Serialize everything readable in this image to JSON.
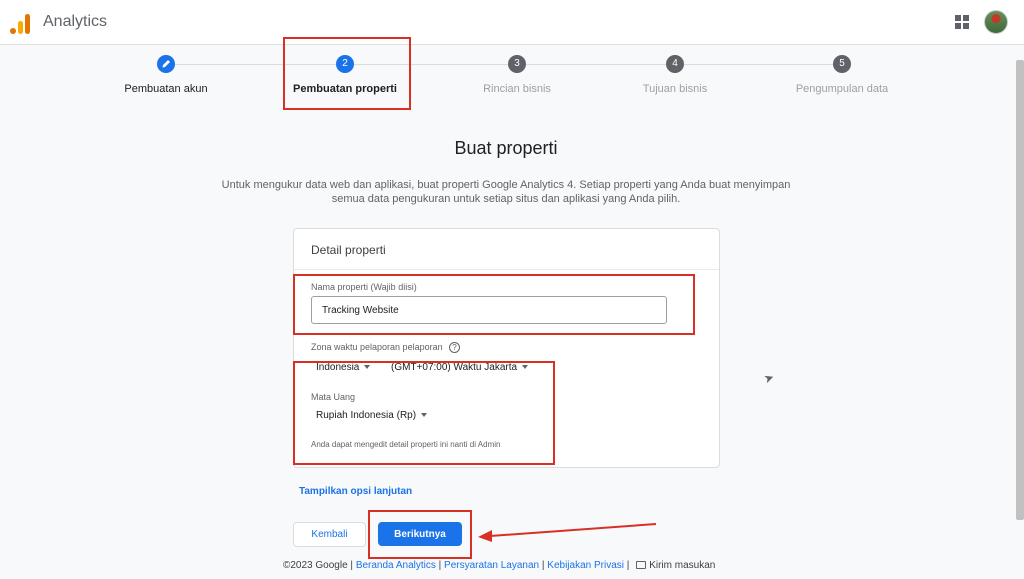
{
  "header": {
    "app_title": "Analytics",
    "apps_icon": "apps-grid-icon",
    "avatar_icon": "user-avatar"
  },
  "stepper": {
    "steps": [
      {
        "number": "",
        "label": "Pembuatan akun",
        "state": "done"
      },
      {
        "number": "2",
        "label": "Pembuatan properti",
        "state": "current"
      },
      {
        "number": "3",
        "label": "Rincian bisnis",
        "state": "todo"
      },
      {
        "number": "4",
        "label": "Tujuan bisnis",
        "state": "todo"
      },
      {
        "number": "5",
        "label": "Pengumpulan data",
        "state": "todo"
      }
    ]
  },
  "main": {
    "heading": "Buat properti",
    "intro": "Untuk mengukur data web dan aplikasi, buat properti Google Analytics 4. Setiap properti yang Anda buat menyimpan semua data pengukuran untuk setiap situs dan aplikasi yang Anda pilih."
  },
  "card": {
    "title": "Detail properti",
    "property_name_label": "Nama properti (Wajib diisi)",
    "property_name_value": "Tracking Website",
    "timezone_label": "Zona waktu pelaporan pelaporan",
    "country": "Indonesia",
    "timezone": "(GMT+07:00) Waktu Jakarta",
    "currency_label": "Mata Uang",
    "currency": "Rupiah Indonesia (Rp)",
    "note": "Anda dapat mengedit detail properti ini nanti di Admin"
  },
  "actions": {
    "advanced_link": "Tampilkan opsi lanjutan",
    "back_label": "Kembali",
    "next_label": "Berikutnya"
  },
  "footer": {
    "copyright": "©2023 Google",
    "sep": "|",
    "home": "Beranda Analytics",
    "terms": "Persyaratan Layanan",
    "privacy": "Kebijakan Privasi",
    "feedback": "Kirim masukan"
  },
  "colors": {
    "accent": "#1a73e8",
    "highlight": "#d93025"
  }
}
